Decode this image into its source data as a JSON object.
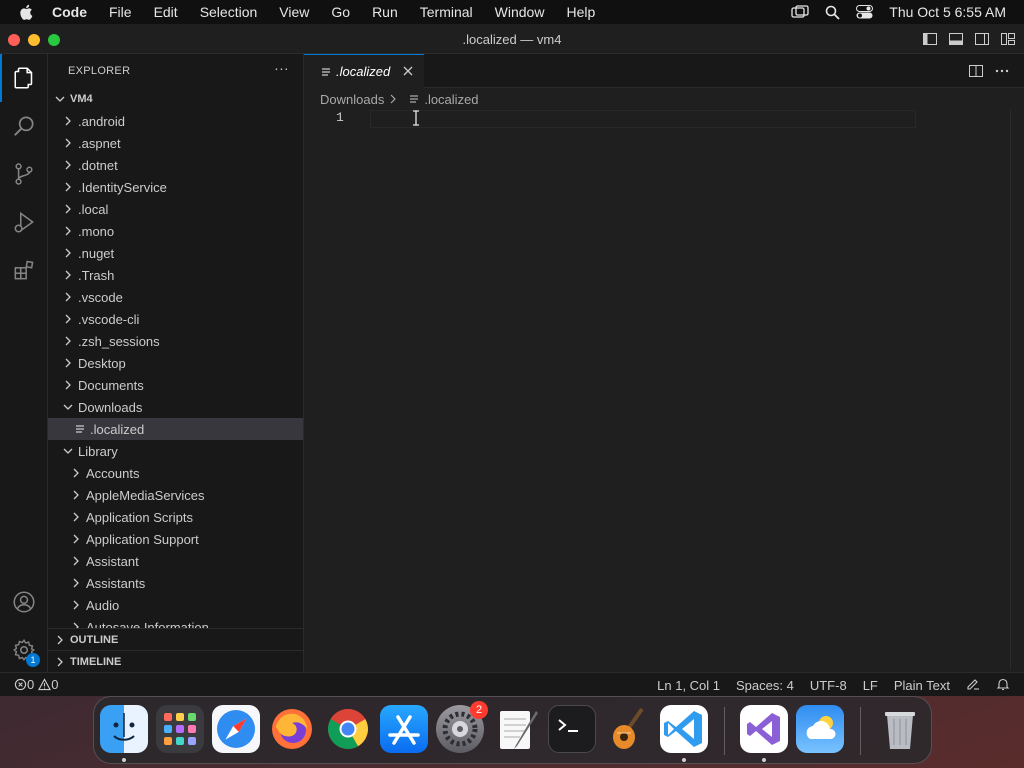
{
  "menubar": {
    "app_name": "Code",
    "items": [
      "File",
      "Edit",
      "Selection",
      "View",
      "Go",
      "Run",
      "Terminal",
      "Window",
      "Help"
    ],
    "clock": "Thu Oct 5  6:55 AM"
  },
  "window": {
    "title": ".localized — vm4"
  },
  "activity_bar": {
    "items": [
      "explorer-icon",
      "search-icon",
      "source-control-icon",
      "run-debug-icon",
      "extensions-icon"
    ],
    "bottom": [
      "account-icon",
      "settings-gear-icon"
    ],
    "settings_badge": "1"
  },
  "explorer": {
    "header": "EXPLORER",
    "root": "VM4",
    "items": [
      {
        "label": ".android",
        "depth": 1,
        "type": "folder",
        "expanded": false
      },
      {
        "label": ".aspnet",
        "depth": 1,
        "type": "folder",
        "expanded": false
      },
      {
        "label": ".dotnet",
        "depth": 1,
        "type": "folder",
        "expanded": false
      },
      {
        "label": ".IdentityService",
        "depth": 1,
        "type": "folder",
        "expanded": false
      },
      {
        "label": ".local",
        "depth": 1,
        "type": "folder",
        "expanded": false
      },
      {
        "label": ".mono",
        "depth": 1,
        "type": "folder",
        "expanded": false
      },
      {
        "label": ".nuget",
        "depth": 1,
        "type": "folder",
        "expanded": false
      },
      {
        "label": ".Trash",
        "depth": 1,
        "type": "folder",
        "expanded": false
      },
      {
        "label": ".vscode",
        "depth": 1,
        "type": "folder",
        "expanded": false
      },
      {
        "label": ".vscode-cli",
        "depth": 1,
        "type": "folder",
        "expanded": false
      },
      {
        "label": ".zsh_sessions",
        "depth": 1,
        "type": "folder",
        "expanded": false
      },
      {
        "label": "Desktop",
        "depth": 1,
        "type": "folder",
        "expanded": false
      },
      {
        "label": "Documents",
        "depth": 1,
        "type": "folder",
        "expanded": false
      },
      {
        "label": "Downloads",
        "depth": 1,
        "type": "folder",
        "expanded": true
      },
      {
        "label": ".localized",
        "depth": 2,
        "type": "file",
        "selected": true
      },
      {
        "label": "Library",
        "depth": 1,
        "type": "folder",
        "expanded": true
      },
      {
        "label": "Accounts",
        "depth": 2,
        "type": "folder",
        "expanded": false
      },
      {
        "label": "AppleMediaServices",
        "depth": 2,
        "type": "folder",
        "expanded": false
      },
      {
        "label": "Application Scripts",
        "depth": 2,
        "type": "folder",
        "expanded": false
      },
      {
        "label": "Application Support",
        "depth": 2,
        "type": "folder",
        "expanded": false
      },
      {
        "label": "Assistant",
        "depth": 2,
        "type": "folder",
        "expanded": false
      },
      {
        "label": "Assistants",
        "depth": 2,
        "type": "folder",
        "expanded": false
      },
      {
        "label": "Audio",
        "depth": 2,
        "type": "folder",
        "expanded": false
      },
      {
        "label": "Autosave Information",
        "depth": 2,
        "type": "folder",
        "expanded": false
      }
    ],
    "outline_label": "OUTLINE",
    "timeline_label": "TIMELINE"
  },
  "editor": {
    "tab_label": ".localized",
    "breadcrumb": [
      "Downloads",
      ".localized"
    ],
    "line_numbers": [
      "1"
    ]
  },
  "statusbar": {
    "errors": "0",
    "warnings": "0",
    "position": "Ln 1, Col 1",
    "spaces": "Spaces: 4",
    "encoding": "UTF-8",
    "eol": "LF",
    "language": "Plain Text"
  },
  "dock": {
    "apps": [
      "finder-icon",
      "launchpad-icon",
      "safari-icon",
      "firefox-icon",
      "chrome-icon",
      "app-store-icon",
      "system-settings-icon",
      "textedit-icon",
      "terminal-icon",
      "garageband-icon",
      "vscode-icon",
      "visual-studio-icon",
      "weather-icon",
      "trash-icon"
    ],
    "system_settings_badge": "2"
  },
  "colors": {
    "accent": "#0078d4",
    "sidebar_bg": "#181818",
    "editor_bg": "#1f1f1f",
    "selection_bg": "#37373d"
  }
}
